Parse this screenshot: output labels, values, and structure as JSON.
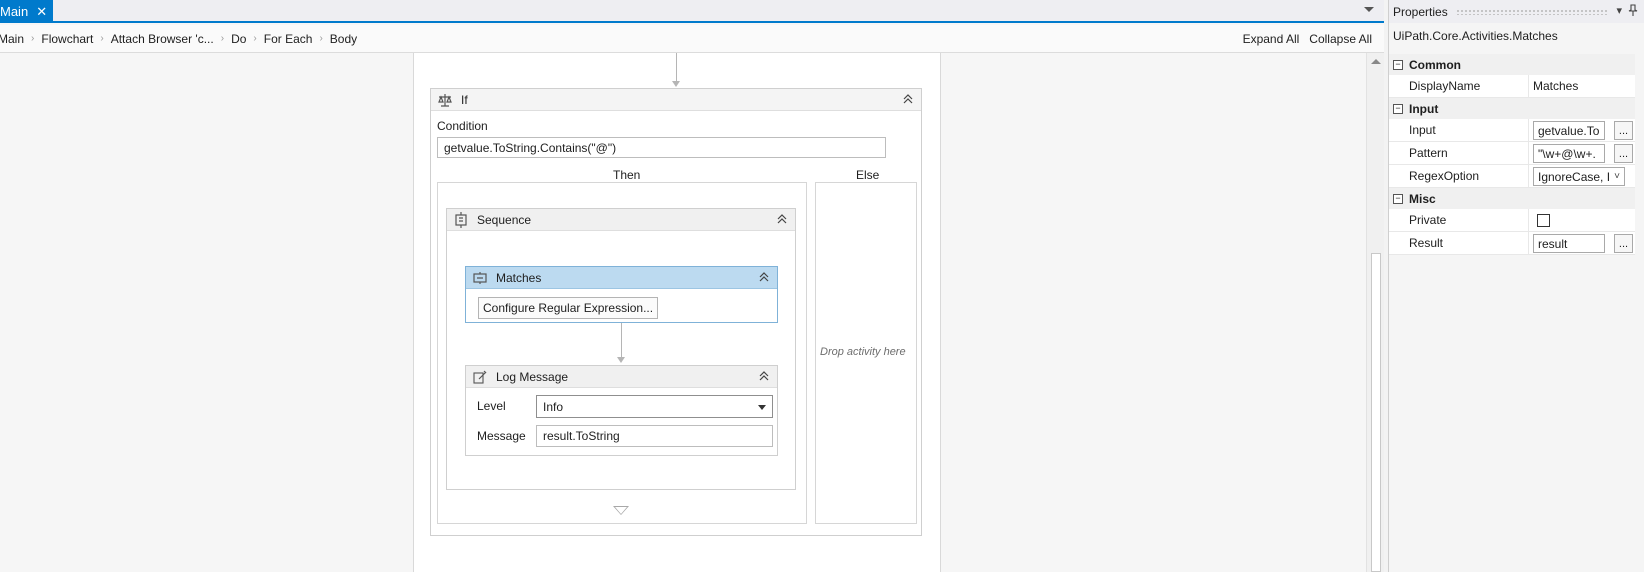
{
  "tab": {
    "label": "Main",
    "close_glyph": "✕"
  },
  "breadcrumb": {
    "items": [
      "Main",
      "Flowchart",
      "Attach Browser 'c...",
      "Do",
      "For Each",
      "Body"
    ],
    "separator": "›",
    "expand_all": "Expand All",
    "collapse_all": "Collapse All"
  },
  "if_activity": {
    "title": "If",
    "condition_label": "Condition",
    "condition_value": "getvalue.ToString.Contains(\"@\")",
    "then_label": "Then",
    "else_label": "Else",
    "else_drop_hint": "Drop activity here"
  },
  "sequence": {
    "title": "Sequence"
  },
  "matches": {
    "title": "Matches",
    "configure_button": "Configure Regular Expression..."
  },
  "log_message": {
    "title": "Log Message",
    "level_label": "Level",
    "level_value": "Info",
    "message_label": "Message",
    "message_value": "result.ToString"
  },
  "properties": {
    "title": "Properties",
    "type_name": "UiPath.Core.Activities.Matches",
    "categories": {
      "common": "Common",
      "input": "Input",
      "misc": "Misc"
    },
    "rows": {
      "display_name": {
        "name": "DisplayName",
        "value": "Matches"
      },
      "input": {
        "name": "Input",
        "value": "getvalue.To"
      },
      "pattern": {
        "name": "Pattern",
        "value": "\"\\w+@\\w+."
      },
      "regex_option": {
        "name": "RegexOption",
        "value": "IgnoreCase, I"
      },
      "private": {
        "name": "Private",
        "checked": false
      },
      "result": {
        "name": "Result",
        "value": "result"
      }
    },
    "ellipsis": "..."
  },
  "colors": {
    "accent": "#007acc",
    "selected_header": "#bcdaf0"
  }
}
